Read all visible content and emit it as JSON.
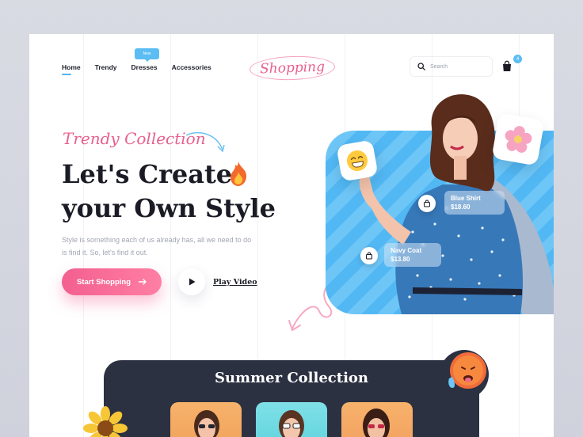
{
  "nav": {
    "items": [
      "Home",
      "Trendy",
      "Dresses",
      "Accessories"
    ],
    "active": "Home",
    "badge": "New"
  },
  "brand": {
    "logo": "Shopping"
  },
  "search": {
    "placeholder": "Search"
  },
  "cart": {
    "count": "4"
  },
  "hero": {
    "eyebrow": "Trendy Collection",
    "headline_line1": "Let's Create",
    "headline_line2": "your Own Style",
    "description": "Style is something each of us already has, all we need to do is find it. So, let's find it out.",
    "cta_label": "Start Shopping",
    "video_label": "Play Video"
  },
  "products": [
    {
      "name": "Blue Shirt",
      "price": "$18.60"
    },
    {
      "name": "Navy Coat",
      "price": "$13.80"
    }
  ],
  "summer": {
    "title": "Summer Collection"
  },
  "colors": {
    "accent_pink": "#f35f8f",
    "accent_blue": "#52b8f4",
    "dark": "#1a1b25",
    "summer_bg": "#2c3142"
  },
  "icons": [
    "search-icon",
    "bag-icon",
    "arrow-right-icon",
    "play-icon",
    "fire-icon",
    "grin-emoji-icon",
    "flower-icon",
    "hot-face-emoji-icon",
    "sunflower-icon"
  ]
}
